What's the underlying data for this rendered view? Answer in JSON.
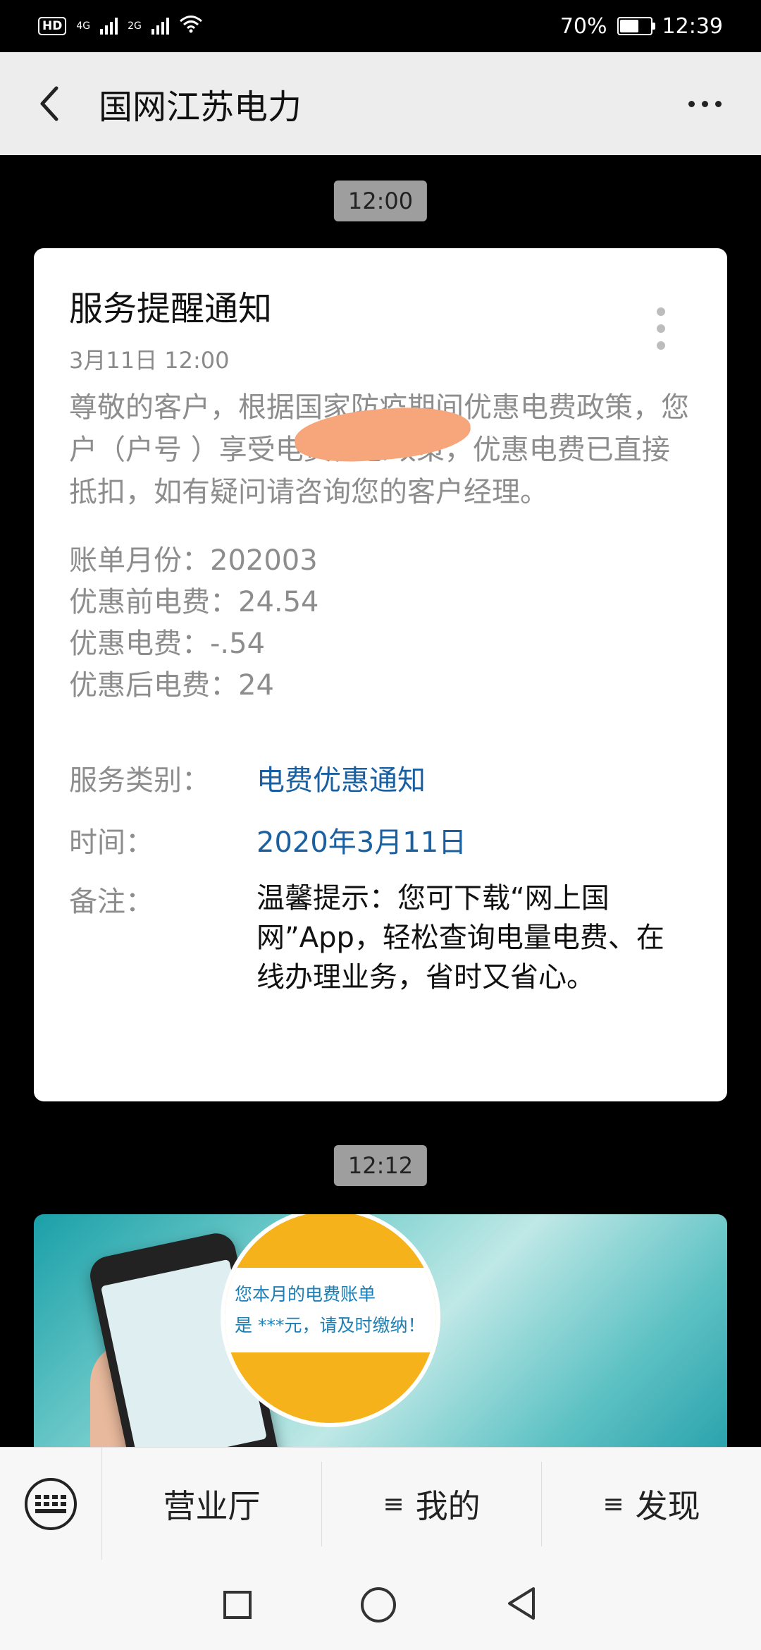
{
  "status_bar": {
    "hd": "HD",
    "net1": "4G",
    "net2": "2G",
    "battery": "70%",
    "battery_level": 0.7,
    "time": "12:39"
  },
  "nav": {
    "title": "国网江苏电力"
  },
  "messages": [
    {
      "timestamp": "12:00",
      "card": {
        "title": "服务提醒通知",
        "date": "3月11日  12:00",
        "body": "尊敬的客户，根据国家防疫期间优惠电费政策，您户（户号 ）享受电费优惠政策，优惠电费已直接抵扣，如有疑问请咨询您的客户经理。",
        "lines": [
          "账单月份：202003",
          "优惠前电费：24.54",
          "优惠电费：-.54",
          "优惠后电费：24"
        ],
        "fields": [
          {
            "key": "服务类别：",
            "value": "电费优惠通知"
          },
          {
            "key": "时间：",
            "value": "2020年3月11日"
          },
          {
            "key": "备注：",
            "value": "温馨提示：您可下载“网上国网”App，轻松查询电量电费、在线办理业务，省时又省心。"
          }
        ]
      }
    },
    {
      "timestamp": "12:12",
      "banner": {
        "text_line1": "您本月的电费账单",
        "text_line2": "是 ***元，请及时缴纳！"
      }
    }
  ],
  "menu": {
    "items": [
      "营业厅",
      "我的",
      "发现"
    ]
  },
  "colors": {
    "accent_blue": "#1a5fa0",
    "nav_bg": "#ededed",
    "timestamp_bg": "#9e9e9e",
    "banner_yellow": "#f5b21a"
  },
  "icons": [
    "back-arrow-icon",
    "more-icon",
    "keyboard-icon",
    "menu-lines-icon",
    "square-icon",
    "home-circle-icon",
    "back-triangle-icon"
  ]
}
